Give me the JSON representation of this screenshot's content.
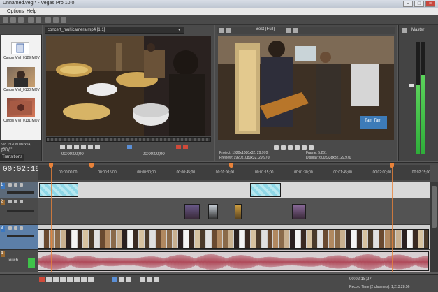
{
  "window": {
    "title": "Unnamed.veg * - Vegas Pro 10.0"
  },
  "menu": [
    "Options",
    "Help"
  ],
  "explorer": {
    "items": [
      {
        "label": "Canon MVI_0129.MOV"
      },
      {
        "label": "Canon MVI_0130.MOV"
      },
      {
        "label": "Canon MVI_0131.MOV"
      }
    ],
    "info_lines": [
      "Vid 1920x1080x24, 29.970",
      "[Dirty]",
      "[Dirty]",
      "[Dirty]"
    ],
    "tab_label": "Transitions"
  },
  "trimmer": {
    "file_label": "concert_multicamera.mp4  [1:1]",
    "timecode_in": "00:00:00;00",
    "timecode_out": "00:00:00;00"
  },
  "preview": {
    "quality": "Best (Full)",
    "info": {
      "project": "Project:  1920x1080x32, 29.970i",
      "preview": "Preview:  1920x1080x32, 29.970i",
      "frame": "Frame:  5,261",
      "display": "Display:  600x338x32, 29.970"
    },
    "overlay_text": "Tam Tam"
  },
  "master": {
    "label": "Master",
    "levels": [
      0.62,
      0.7
    ]
  },
  "timeline": {
    "timecode": "00:02:18;27",
    "ruler_ticks": [
      "00:00:00;00",
      "00:00:15;00",
      "00:00:30;00",
      "00:00:45;00",
      "00:01:00;00",
      "00:01:15;00",
      "00:01:30;00",
      "00:01:45;00",
      "00:02:00;00",
      "00:02:15;00"
    ],
    "tracks": [
      {
        "num": "1"
      },
      {
        "num": "2"
      },
      {
        "num": "3"
      },
      {
        "num": "4"
      }
    ],
    "track4_label": "Touch"
  },
  "transport": {
    "record_time": "Record Time (2 channels): 1,213:28:56",
    "position": "00:02:18;27"
  },
  "colors": {
    "accent_marker": "#e8823a",
    "meter": "#3fc24a",
    "audio_wave": "#b04a5a",
    "selected_event": "#8fd7e6"
  }
}
